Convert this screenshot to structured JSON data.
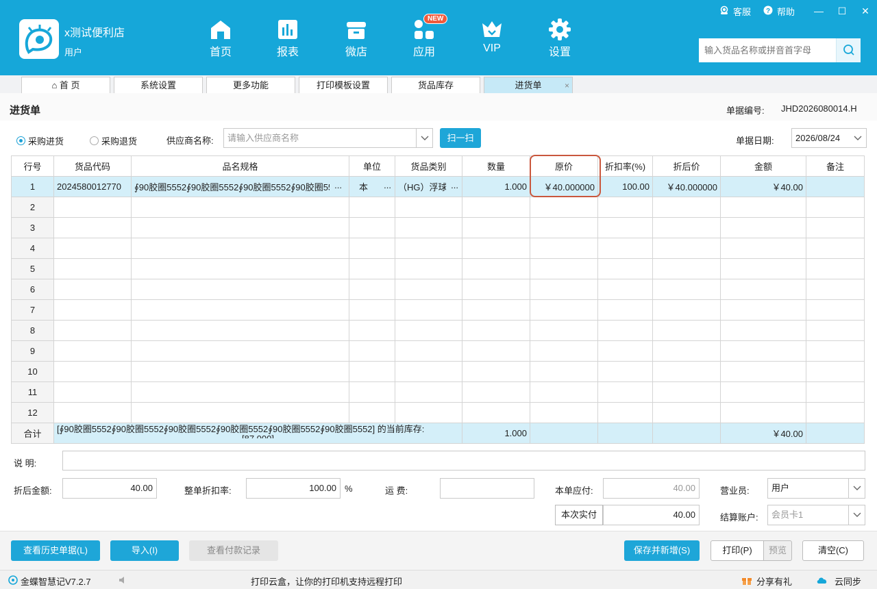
{
  "header": {
    "store_name": "x测试便利店",
    "store_user": "用户",
    "nav": [
      {
        "label": "首页",
        "icon": "home-icon"
      },
      {
        "label": "报表",
        "icon": "report-icon"
      },
      {
        "label": "微店",
        "icon": "shop-icon"
      },
      {
        "label": "应用",
        "icon": "apps-icon",
        "badge": "NEW"
      },
      {
        "label": "VIP",
        "icon": "vip-crown-icon"
      },
      {
        "label": "设置",
        "icon": "gear-icon"
      }
    ],
    "service": "客服",
    "help": "帮助",
    "search_placeholder": "输入货品名称或拼音首字母",
    "win_min": "—",
    "win_max": "☐",
    "win_close": "✕"
  },
  "tabs": [
    {
      "label": "首 页",
      "icon": "⌂"
    },
    {
      "label": "系统设置"
    },
    {
      "label": "更多功能"
    },
    {
      "label": "打印模板设置"
    },
    {
      "label": "货品库存"
    },
    {
      "label": "进货单",
      "active": true,
      "close": "×"
    }
  ],
  "page": {
    "title": "进货单",
    "doc_no_label": "单据编号:",
    "doc_no": "JHD2026080014.H"
  },
  "form": {
    "radio_purchase": "采购进货",
    "radio_return": "采购退货",
    "supplier_label": "供应商名称:",
    "supplier_placeholder": "请输入供应商名称",
    "scan_button": "扫一扫",
    "date_label": "单据日期:",
    "date_value": "2026/08/24"
  },
  "grid": {
    "columns": [
      "行号",
      "货品代码",
      "品名规格",
      "单位",
      "货品类别",
      "数量",
      "原价",
      "折扣率(%)",
      "折后价",
      "金额",
      "备注"
    ],
    "row1": {
      "no": "1",
      "code": "2024580012770",
      "name": "∮90胶圈5552∮90胶圈5552∮90胶圈5552∮90胶圈5552",
      "name_more": "...",
      "unit": "本",
      "unit_more": "...",
      "category": "（HG）浮球阀",
      "category_more": "...",
      "qty": "1.000",
      "price": "￥40.000000",
      "discount": "100.00",
      "disc_price": "￥40.000000",
      "amount": "￥40.00",
      "note": ""
    },
    "empty_rows": [
      "2",
      "3",
      "4",
      "5",
      "6",
      "7",
      "8",
      "9",
      "10",
      "11",
      "12"
    ],
    "sum": {
      "label": "合计",
      "stock_info": "[∮90胶圈5552∮90胶圈5552∮90胶圈5552∮90胶圈5552∮90胶圈5552∮90胶圈5552] 的当前库存:",
      "stock_value": "[87.000]",
      "qty": "1.000",
      "amount": "￥40.00"
    }
  },
  "footer_form": {
    "remark_label": "说  明:",
    "after_disc_label": "折后金额:",
    "after_disc_value": "40.00",
    "whole_disc_label": "整单折扣率:",
    "whole_disc_value": "100.00",
    "percent": "%",
    "freight_label": "运    费:",
    "payable_label": "本单应付:",
    "payable_value": "40.00",
    "paid_button": "本次实付",
    "paid_value": "40.00",
    "salesman_label": "营业员:",
    "salesman_value": "用户",
    "account_label": "结算账户:",
    "account_value": "会员卡1"
  },
  "actions": {
    "history": "查看历史单据(L)",
    "import": "导入(I)",
    "payment_record": "查看付款记录",
    "save_new": "保存并新增(S)",
    "print": "打印(P)",
    "preview": "预览",
    "clear": "清空(C)"
  },
  "status": {
    "version": "金蝶智慧记V7.2.7",
    "ad": "打印云盒，让你的打印机支持远程打印",
    "share": "分享有礼",
    "sync": "云同步"
  },
  "colors": {
    "header": "#16a7d9",
    "selected_row": "#d4eff9",
    "highlight": "#c9573d"
  }
}
